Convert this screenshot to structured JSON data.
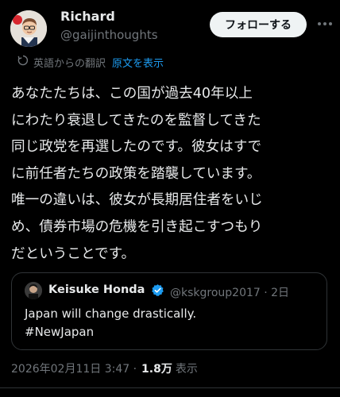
{
  "author": {
    "name": "Richard",
    "handle": "@gaijinthoughts"
  },
  "follow_button": "フォローする",
  "translation": {
    "label": "英語からの翻訳",
    "show_original": "原文を表示"
  },
  "tweet_text": "あなたたちは、この国が過去40年以上\nにわたり衰退してきたのを監督してきた\n同じ政党を再選したのです。彼女はすで\nに前任者たちの政策を踏襲しています。\n唯一の違いは、彼女が長期居住者をいじ\nめ、債券市場の危機を引き起こすつもり\nだということです。",
  "quoted_tweet": {
    "name": "Keisuke Honda",
    "handle_time": "@kskgroup2017 · 2日",
    "text": "Japan will change drastically.\n#NewJapan"
  },
  "meta": {
    "timestamp": "2026年02月11日 3:47 ·",
    "views": "1.8万",
    "views_label": "表示"
  },
  "colors": {
    "background": "#000000",
    "text": "#e7e9ea",
    "muted": "#71767b",
    "link": "#1d9bf0",
    "border": "#2f3336"
  }
}
